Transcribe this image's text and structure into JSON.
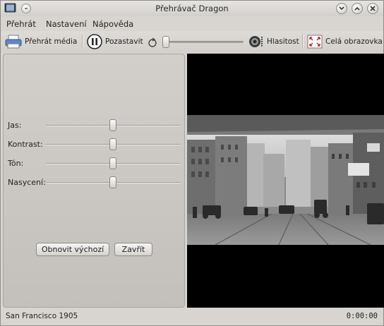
{
  "window": {
    "title": "Přehrávač Dragon"
  },
  "menu": {
    "items": [
      {
        "label": "Přehrát"
      },
      {
        "label": "Nastavení"
      },
      {
        "label": "Nápověda"
      }
    ]
  },
  "toolbar": {
    "play_media_label": "Přehrát média",
    "pause_label": "Pozastavit",
    "volume_label": "Hlasitost",
    "fullscreen_label": "Celá obrazovka",
    "seek_position": 0.0
  },
  "video_settings": {
    "sliders": [
      {
        "label": "Jas:",
        "value": 0.5
      },
      {
        "label": "Kontrast:",
        "value": 0.5
      },
      {
        "label": "Tón:",
        "value": 0.5
      },
      {
        "label": "Nasycení:",
        "value": 0.5
      }
    ],
    "reset_label": "Obnovit výchozí",
    "close_label": "Zavřít"
  },
  "status": {
    "title": "San Francisco 1905",
    "time": "0:00:00"
  },
  "colors": {
    "window_bg": "#d8d5d1",
    "video_bg": "#000000"
  }
}
